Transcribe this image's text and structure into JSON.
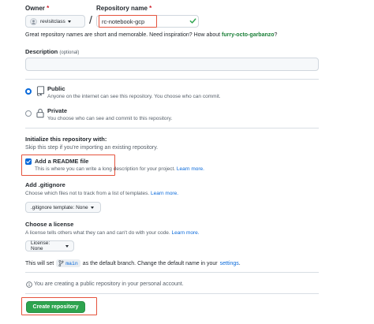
{
  "owner": {
    "label": "Owner",
    "required_mark": "*",
    "value": "revisitclass"
  },
  "repository_name": {
    "label": "Repository name",
    "required_mark": "*",
    "separator": "/",
    "value": "rc-notebook-gcp"
  },
  "name_hint": {
    "text": "Great repository names are short and memorable. Need inspiration? How about",
    "suggestion": "furry-octo-garbanzo",
    "suffix": "?"
  },
  "description": {
    "label": "Description",
    "optional": "(optional)",
    "value": ""
  },
  "visibility": {
    "public": {
      "title": "Public",
      "desc": "Anyone on the internet can see this repository. You choose who can commit.",
      "selected": true
    },
    "private": {
      "title": "Private",
      "desc": "You choose who can see and commit to this repository.",
      "selected": false
    }
  },
  "initialize": {
    "title": "Initialize this repository with:",
    "subtitle": "Skip this step if you're importing an existing repository.",
    "readme_title": "Add a README file",
    "readme_desc": "This is where you can write a long description for your project.",
    "readme_link": "Learn more.",
    "readme_checked": true
  },
  "gitignore": {
    "title": "Add .gitignore",
    "desc": "Choose which files not to track from a list of templates.",
    "link": "Learn more.",
    "button": ".gitignore template: None"
  },
  "license": {
    "title": "Choose a license",
    "desc": "A license tells others what they can and can't do with your code.",
    "link": "Learn more.",
    "button": "License: None"
  },
  "branch_note": {
    "prefix": "This will set",
    "branch": "main",
    "middle": "as the default branch. Change the default name in your",
    "link": "settings",
    "suffix": "."
  },
  "public_notice": "You are creating a public repository in your personal account.",
  "create_button": "Create repository",
  "colors": {
    "accent": "#0969da",
    "success": "#2da44e",
    "highlight_box": "#e5533d",
    "suggestion": "#1a7f37"
  },
  "icons": [
    "owner-avatar-icon",
    "caret-down-icon",
    "check-valid-icon",
    "public-repo-icon",
    "private-lock-icon",
    "branch-icon",
    "info-icon",
    "checkbox-check-icon"
  ]
}
